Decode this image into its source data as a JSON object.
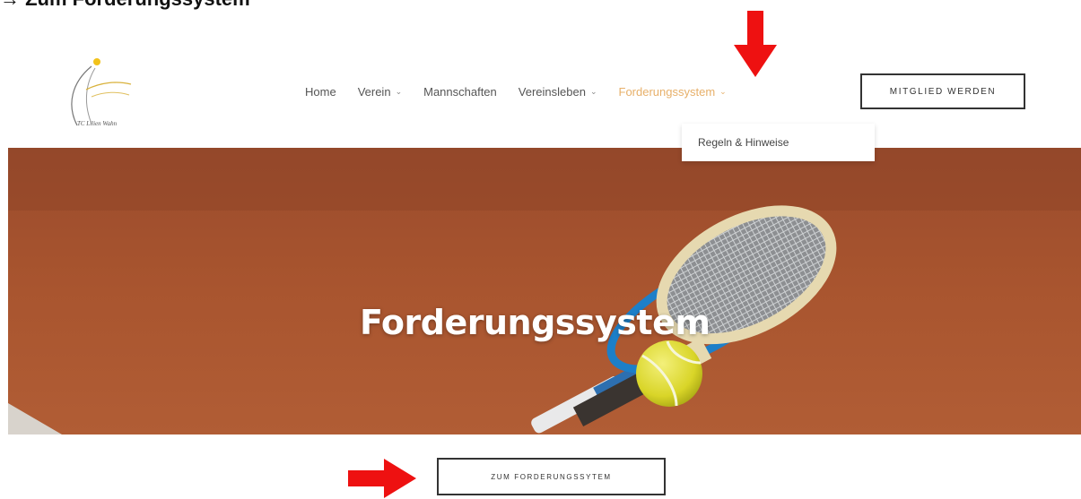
{
  "document": {
    "heading": "→ Zum Forderungssystem"
  },
  "logo": {
    "text": "TC Lilien Wahn"
  },
  "nav": {
    "items": [
      {
        "label": "Home",
        "has_dropdown": false
      },
      {
        "label": "Verein",
        "has_dropdown": true
      },
      {
        "label": "Mannschaften",
        "has_dropdown": false
      },
      {
        "label": "Vereinsleben",
        "has_dropdown": true
      },
      {
        "label": "Forderungssystem",
        "has_dropdown": true,
        "active": true
      }
    ],
    "cta_label": "MITGLIED WERDEN",
    "dropdown_items": [
      "Regeln & Hinweise"
    ]
  },
  "hero": {
    "title": "Forderungssystem"
  },
  "cta_bottom": {
    "label": "ZUM FORDERUNGSSYTEM"
  },
  "colors": {
    "accent": "#e7b06a",
    "arrow": "#ee1111",
    "court": "#a9512c"
  },
  "icons": {
    "chevron": "chevron-down-icon",
    "annotation_arrow_down": "arrow-down-icon",
    "annotation_arrow_right": "arrow-right-icon"
  }
}
